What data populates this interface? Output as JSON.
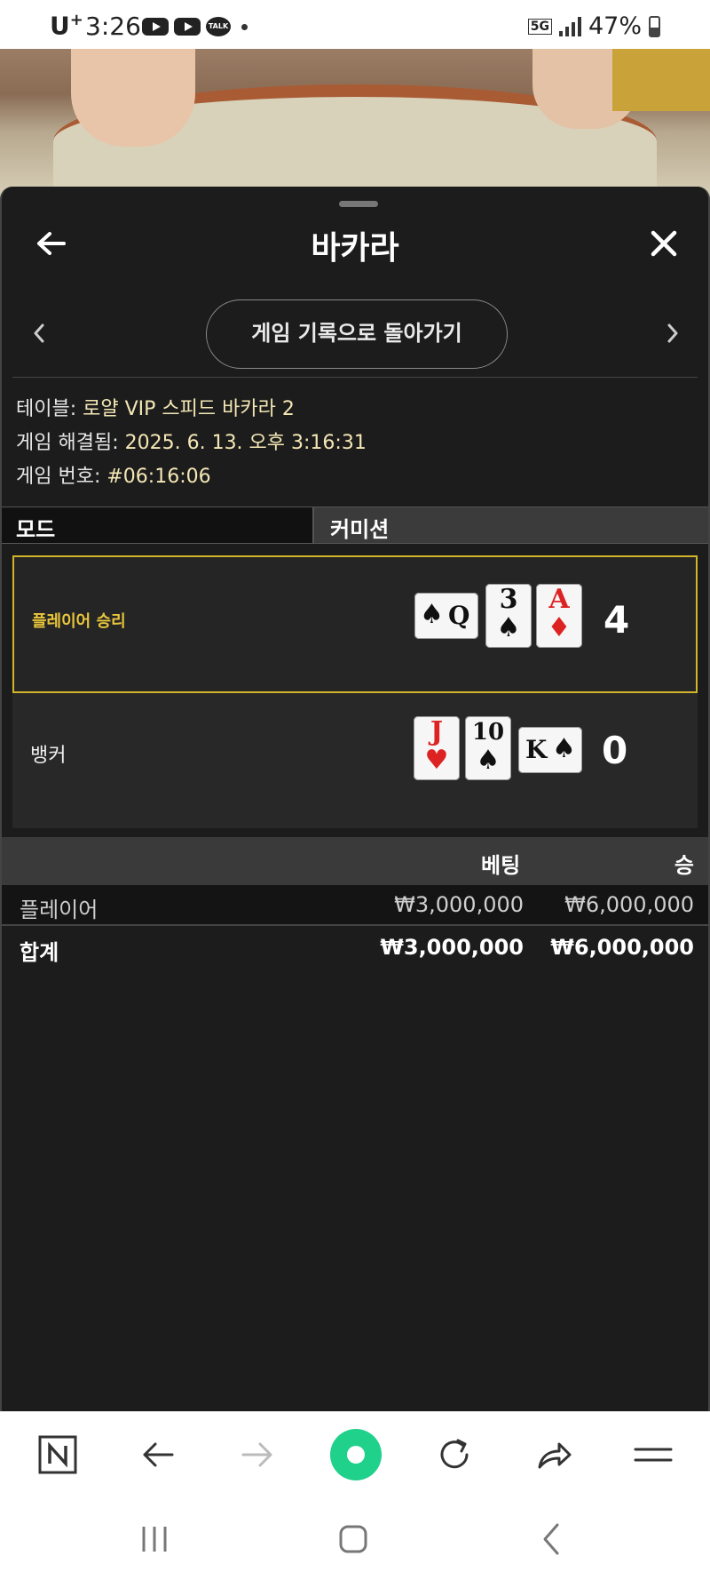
{
  "status": {
    "carrier": "U",
    "carrier_sup": "+",
    "time": "3:26",
    "talk": "TALK",
    "network": "5G",
    "battery": "47%"
  },
  "header": {
    "title": "바카라",
    "back_icon": "arrow-left-icon",
    "close_icon": "close-icon"
  },
  "nav": {
    "back_to_history": "게임 기록으로 돌아가기"
  },
  "info": {
    "table_label": "테이블: ",
    "table_value": "로얄 VIP 스피드 바카라 2",
    "resolved_label": "게임 해결됨: ",
    "resolved_value": "2025. 6. 13. 오후 3:16:31",
    "number_label": "게임 번호: ",
    "number_value": "#06:16:06"
  },
  "mode": {
    "label": "모드",
    "value": "커미션"
  },
  "result": {
    "player_label": "플레이어 승리",
    "player_score": "4",
    "player_cards": [
      {
        "rank": "Q",
        "suit": "♠",
        "color": "black",
        "orientation": "side"
      },
      {
        "rank": "3",
        "suit": "♠",
        "color": "black",
        "orientation": "upright"
      },
      {
        "rank": "A",
        "suit": "♦",
        "color": "red",
        "orientation": "upright"
      }
    ],
    "banker_label": "뱅커",
    "banker_score": "0",
    "banker_cards": [
      {
        "rank": "J",
        "suit": "♥",
        "color": "red",
        "orientation": "upright"
      },
      {
        "rank": "10",
        "suit": "♠",
        "color": "black",
        "orientation": "upright"
      },
      {
        "rank": "K",
        "suit": "♠",
        "color": "black",
        "orientation": "side"
      }
    ]
  },
  "bets": {
    "col_bet": "베팅",
    "col_win": "승",
    "rows": [
      {
        "name": "플레이어",
        "bet": "₩3,000,000",
        "win": "₩6,000,000"
      }
    ],
    "total": {
      "name": "합계",
      "bet": "₩3,000,000",
      "win": "₩6,000,000"
    }
  },
  "colors": {
    "panel_bg": "#1c1c1c",
    "win_highlight": "#d3b52c",
    "accent_green": "#1fd18a"
  }
}
